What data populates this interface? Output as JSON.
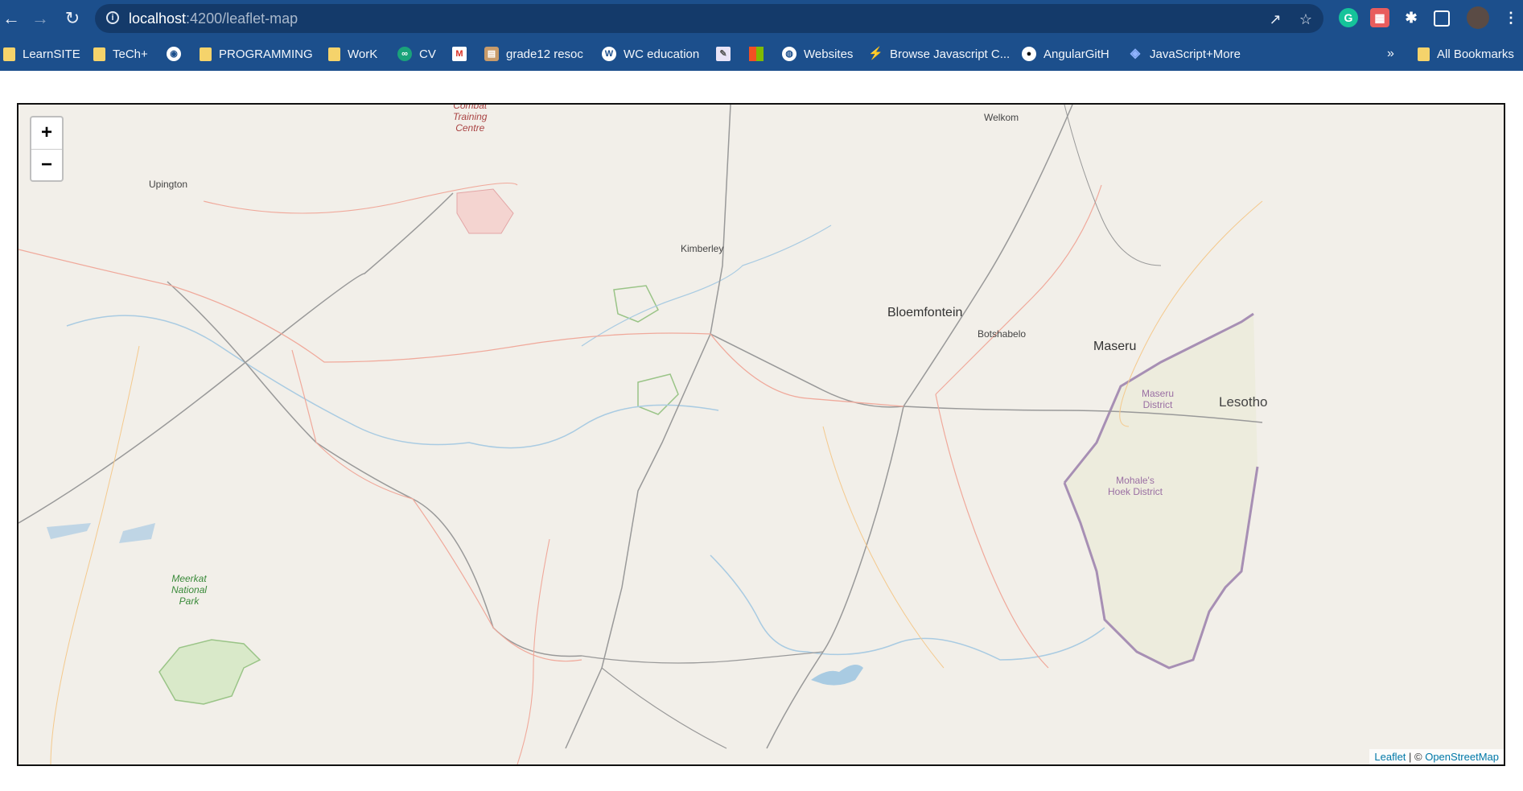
{
  "browser": {
    "url_host": "localhost",
    "url_path": ":4200/leaflet-map",
    "bookmarks": [
      {
        "label": "LearnSITE",
        "icon": "folder-icon"
      },
      {
        "label": "TeCh+",
        "icon": "folder-icon"
      },
      {
        "label": "",
        "icon": "github-icon"
      },
      {
        "label": "PROGRAMMING",
        "icon": "folder-icon"
      },
      {
        "label": "WorK",
        "icon": "folder-icon"
      },
      {
        "label": "CV",
        "icon": "cv-icon"
      },
      {
        "label": "",
        "icon": "gmail-icon"
      },
      {
        "label": "grade12 resoc",
        "icon": "book-icon"
      },
      {
        "label": "WC education",
        "icon": "education-icon"
      },
      {
        "label": "",
        "icon": "image-icon"
      },
      {
        "label": "",
        "icon": "microsoft-icon"
      },
      {
        "label": "Websites",
        "icon": "globe-icon"
      },
      {
        "label": "Browse Javascript C...",
        "icon": "leaf-icon"
      },
      {
        "label": "AngularGitH",
        "icon": "github-icon"
      },
      {
        "label": "JavaScript+More",
        "icon": "diamond-icon"
      }
    ],
    "overflow": "»",
    "all_bookmarks": "All Bookmarks"
  },
  "map": {
    "zoom_in": "+",
    "zoom_out": "−",
    "attribution_leaflet": "Leaflet",
    "attribution_sep": " | © ",
    "attribution_osm": "OpenStreetMap",
    "labels": {
      "upington": "Upington",
      "kimberley": "Kimberley",
      "bloemfontein": "Bloemfontein",
      "botshabelo": "Botshabelo",
      "maseru": "Maseru",
      "welkom": "Welkom",
      "lesotho": "Lesotho",
      "maseru_district_1": "Maseru",
      "maseru_district_2": "District",
      "mohales_1": "Mohale's",
      "mohales_2": "Hoek District",
      "meerkat_1": "Meerkat",
      "meerkat_2": "National",
      "meerkat_3": "Park",
      "combat_1": "Combat",
      "combat_2": "Training",
      "combat_3": "Centre"
    }
  }
}
